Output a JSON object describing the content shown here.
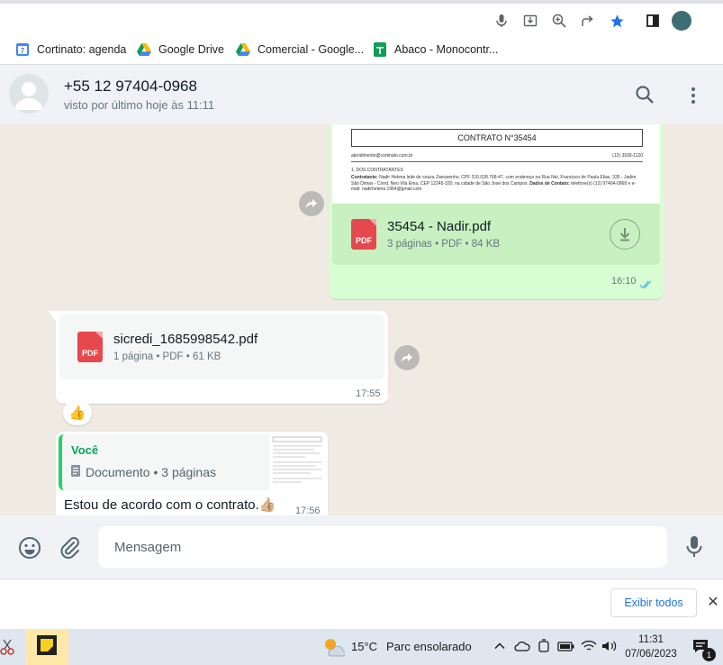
{
  "bookmarks": [
    {
      "label": "Cortinato: agenda",
      "icon": "calendar-icon"
    },
    {
      "label": "Google Drive",
      "icon": "google-drive-icon"
    },
    {
      "label": "Comercial - Google...",
      "icon": "google-drive-icon"
    },
    {
      "label": "Abaco - Monocontr...",
      "icon": "google-sheets-icon"
    }
  ],
  "header": {
    "contact_name": "+55 12 97404-0968",
    "status": "visto por último hoje às 11:11"
  },
  "messages": {
    "contract_preview": {
      "title": "CONTRATO N°35454",
      "email_line": "atendimento@cortinato.com.br",
      "phone_line": "(12) 3939-1120",
      "section": "1. DOS CONTRATANTES",
      "body_bold": "Contratante:",
      "body_text": "Nadir Helena leite de souza Zamarenho, CPF 316.028.768-47, com endereço na Rua Nei, Francisco de Paula Elias, 335 - Jadim São Dimas - Cond. Neo Vila Ema, CEP 12245-320, na cidade de São José dos Campos.",
      "contact_bold": "Dados de Contato:",
      "contact_text": "telefone(s) (12) 97404-0968 e e-mail: nadirhelena.1964@gmail.com"
    },
    "doc_out": {
      "name": "35454 - Nadir.pdf",
      "meta": "3 páginas • PDF • 84 KB",
      "time": "16:10"
    },
    "doc_in": {
      "name": "sicredi_1685998542.pdf",
      "meta": "1 página • PDF • 61 KB",
      "time": "17:55",
      "reaction": "👍"
    },
    "reply": {
      "quote_author": "Você",
      "quote_text": "Documento • 3 páginas",
      "text": "Estou de acordo com o contrato.👍🏼",
      "time": "17:56"
    },
    "pdf_badge": "PDF"
  },
  "composer": {
    "placeholder": "Mensagem"
  },
  "download_bar": {
    "show_all": "Exibir todos"
  },
  "taskbar": {
    "temperature": "15°C",
    "weather": "Parc ensolarado",
    "time": "11:31",
    "date": "07/06/2023",
    "notifications": "1"
  },
  "colors": {
    "outgoing_bubble": "#d9fdd3",
    "accent_green": "#25d366",
    "read_ticks": "#53bdeb",
    "link_blue": "#1a73e8"
  }
}
